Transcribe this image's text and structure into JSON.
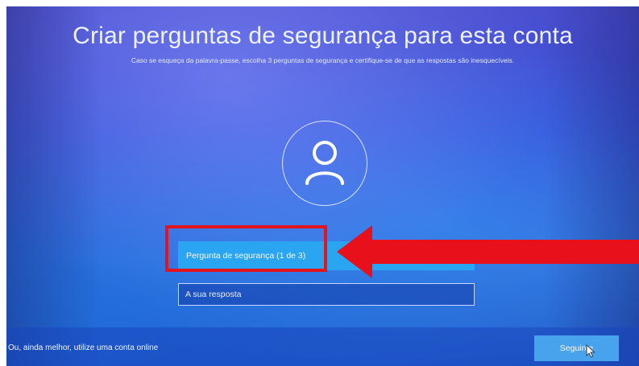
{
  "page": {
    "title": "Criar perguntas de segurança para esta conta",
    "subtitle": "Caso se esqueça da palavra-passe, escolha 3 perguntas de segurança e certifique-se de que as respostas são inesquecíveis."
  },
  "form": {
    "question_select_label": "Pergunta de segurança (1 de 3)",
    "answer_placeholder": "A sua resposta"
  },
  "footer": {
    "online_account_link": "Ou, ainda melhor, utilize uma conta online",
    "next_button_label": "Seguinte"
  },
  "icons": {
    "avatar": "user-icon",
    "arrow": "arrow-left-icon",
    "cursor": "mouse-cursor-icon"
  },
  "colors": {
    "background": "#3a52d8",
    "question_select": "#2aa5f2",
    "next_button": "#49a3ec",
    "highlight": "#e4141e"
  }
}
